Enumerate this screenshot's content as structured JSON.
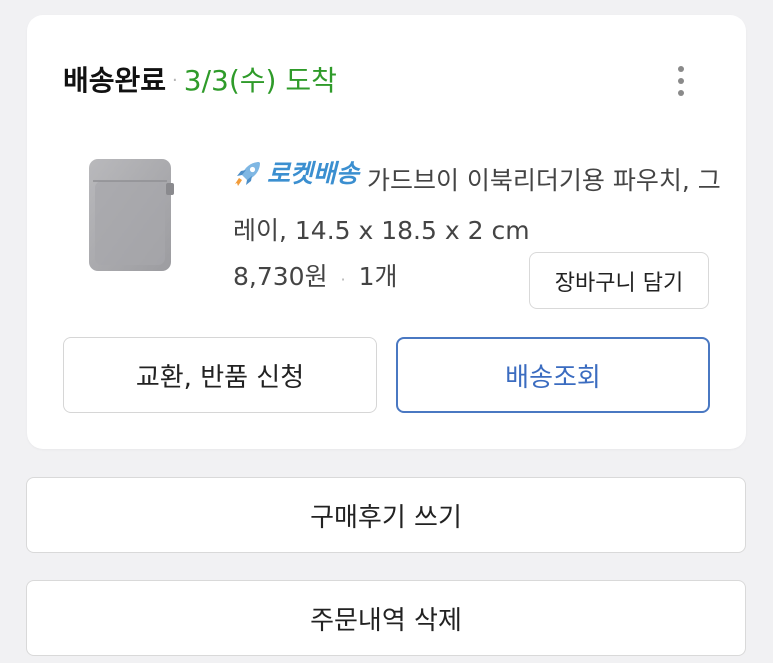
{
  "order": {
    "status_label": "배송완료",
    "separator": "·",
    "arrival": "3/3(수) 도착",
    "more_icon": "more-vertical-icon"
  },
  "product": {
    "rocket_label": "로켓배송",
    "rocket_icon": "rocket-icon",
    "title": " 가드브이 이북리더기용 파우치, 그레이, 14.5 x 18.5 x 2 cm",
    "price": "8,730원",
    "separator": "·",
    "quantity": "1개",
    "image": "gray-pouch-thumbnail",
    "cart_button_label": "장바구니 담기"
  },
  "actions": {
    "exchange_return_label": "교환, 반품 신청",
    "track_delivery_label": "배송조회",
    "write_review_label": "구매후기 쓰기",
    "delete_order_label": "주문내역 삭제"
  },
  "colors": {
    "arrival_green": "#2f9b2a",
    "rocket_blue": "#3b8fd0",
    "track_button_blue": "#4a78c2",
    "page_background": "#f1f1f3"
  }
}
